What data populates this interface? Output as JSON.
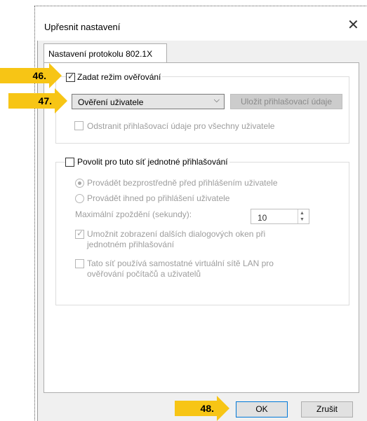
{
  "dialog": {
    "title": "Upřesnit nastavení",
    "close_glyph": "✕"
  },
  "tab": {
    "label": "Nastavení protokolu 802.1X"
  },
  "auth_mode": {
    "checkbox_label": "Zadat režim ověřování",
    "checked": true,
    "select_value": "Ověření uživatele",
    "save_credentials_label": "Uložit přihlašovací údaje",
    "remove_credentials_label": "Odstranit přihlašovací údaje pro všechny uživatele"
  },
  "sso": {
    "checkbox_label": "Povolit pro tuto síť jednotné přihlašování",
    "radio_before": "Provádět bezprostředně před přihlášením uživatele",
    "radio_after": "Provádět ihned po přihlášení uživatele",
    "max_delay_label": "Maximální zpoždění (sekundy):",
    "max_delay_value": "10",
    "allow_dialogs_line1": "Umožnit zobrazení dalších dialogových oken při",
    "allow_dialogs_line2": "jednotném přihlašování",
    "vlan_line1": "Tato síť používá samostatné virtuální sítě LAN pro",
    "vlan_line2": "ověřování počítačů a uživatelů"
  },
  "buttons": {
    "ok": "OK",
    "cancel": "Zrušit"
  },
  "callouts": {
    "c46": "46.",
    "c47": "47.",
    "c48": "48."
  },
  "colors": {
    "callout": "#f7c515",
    "ok_border": "#0078d7"
  },
  "icons": {
    "close": "close-icon",
    "dropdown": "chevron-down-icon",
    "spin_up": "spin-up-icon",
    "spin_down": "spin-down-icon"
  }
}
